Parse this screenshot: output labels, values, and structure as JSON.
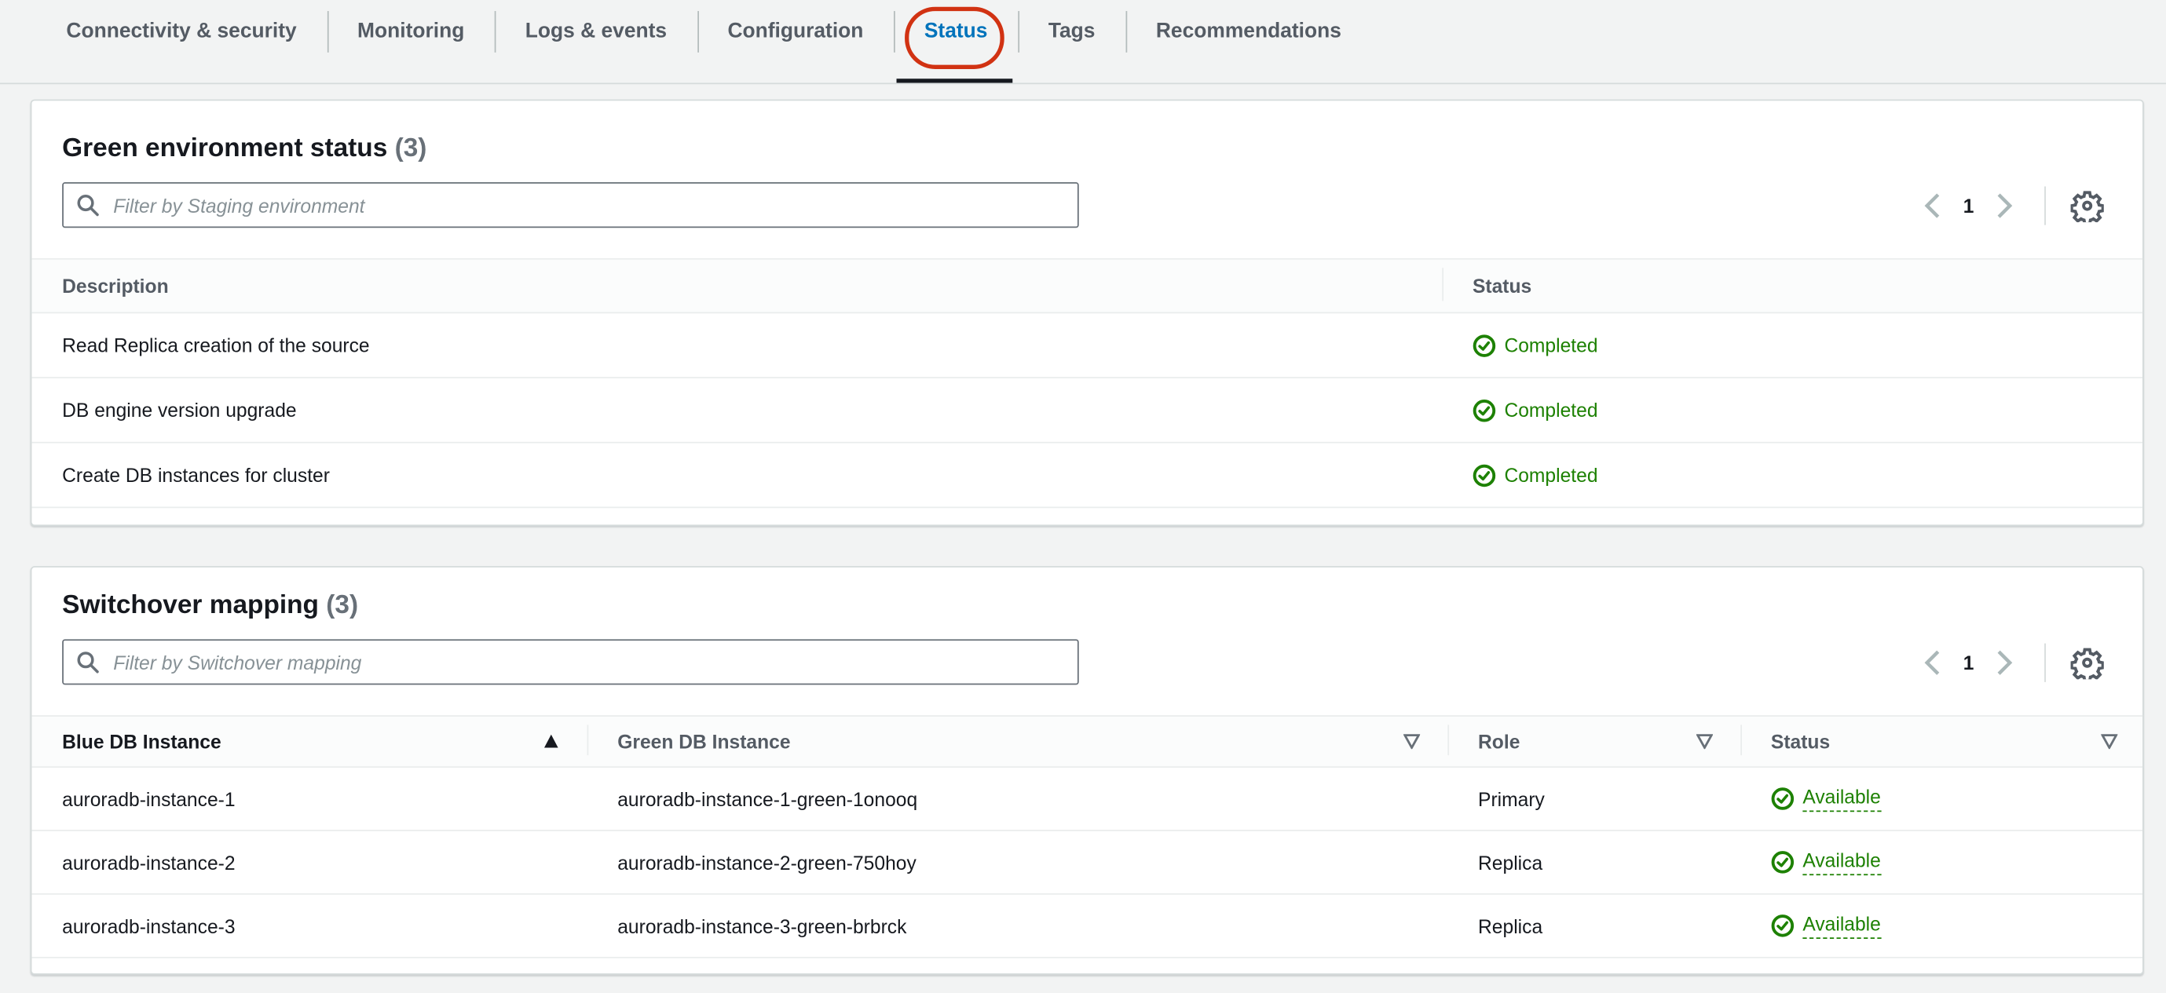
{
  "tabs": {
    "items": [
      {
        "label": "Connectivity & security",
        "active": false
      },
      {
        "label": "Monitoring",
        "active": false
      },
      {
        "label": "Logs & events",
        "active": false
      },
      {
        "label": "Configuration",
        "active": false
      },
      {
        "label": "Status",
        "active": true,
        "annotated_with_red_circle": true
      },
      {
        "label": "Tags",
        "active": false
      },
      {
        "label": "Recommendations",
        "active": false
      }
    ]
  },
  "green_environment_status": {
    "title": "Green environment status",
    "count": "(3)",
    "filter_placeholder": "Filter by Staging environment",
    "pagination": {
      "page": "1",
      "prev_enabled": false,
      "next_enabled": false
    },
    "columns": [
      {
        "label": "Description"
      },
      {
        "label": "Status"
      }
    ],
    "rows": [
      {
        "description": "Read Replica creation of the source",
        "status": "Completed"
      },
      {
        "description": "DB engine version upgrade",
        "status": "Completed"
      },
      {
        "description": "Create DB instances for cluster",
        "status": "Completed"
      }
    ]
  },
  "switchover_mapping": {
    "title": "Switchover mapping",
    "count": "(3)",
    "filter_placeholder": "Filter by Switchover mapping",
    "pagination": {
      "page": "1",
      "prev_enabled": false,
      "next_enabled": false
    },
    "columns": [
      {
        "label": "Blue DB Instance",
        "sort": "ascending"
      },
      {
        "label": "Green DB Instance",
        "sort": "sortable"
      },
      {
        "label": "Role",
        "sort": "sortable"
      },
      {
        "label": "Status",
        "sort": "sortable"
      }
    ],
    "rows": [
      {
        "blue": "auroradb-instance-1",
        "green": "auroradb-instance-1-green-1onooq",
        "role": "Primary",
        "status": "Available"
      },
      {
        "blue": "auroradb-instance-2",
        "green": "auroradb-instance-2-green-750hoy",
        "role": "Replica",
        "status": "Available"
      },
      {
        "blue": "auroradb-instance-3",
        "green": "auroradb-instance-3-green-brbrck",
        "role": "Replica",
        "status": "Available"
      }
    ]
  },
  "icons": {
    "search": "search-icon",
    "gear": "gear-icon",
    "chevron_left": "chevron-left-icon",
    "chevron_right": "chevron-right-icon",
    "check_circle": "check-circle-icon",
    "sort_ascending": "sort-ascending-icon",
    "sortable": "sortable-icon"
  },
  "colors": {
    "page_background": "#f2f3f3",
    "card_background": "#ffffff",
    "card_border": "#d5dbdb",
    "row_border": "#eaeded",
    "active_tab_blue": "#0073bb",
    "tab_text": "#545b64",
    "active_tab_indicator": "#16191f",
    "annotation_red": "#d13212",
    "success_green": "#1d8102",
    "muted_text": "#687078",
    "disabled_control": "#aab7b8",
    "text": "#16191f"
  }
}
